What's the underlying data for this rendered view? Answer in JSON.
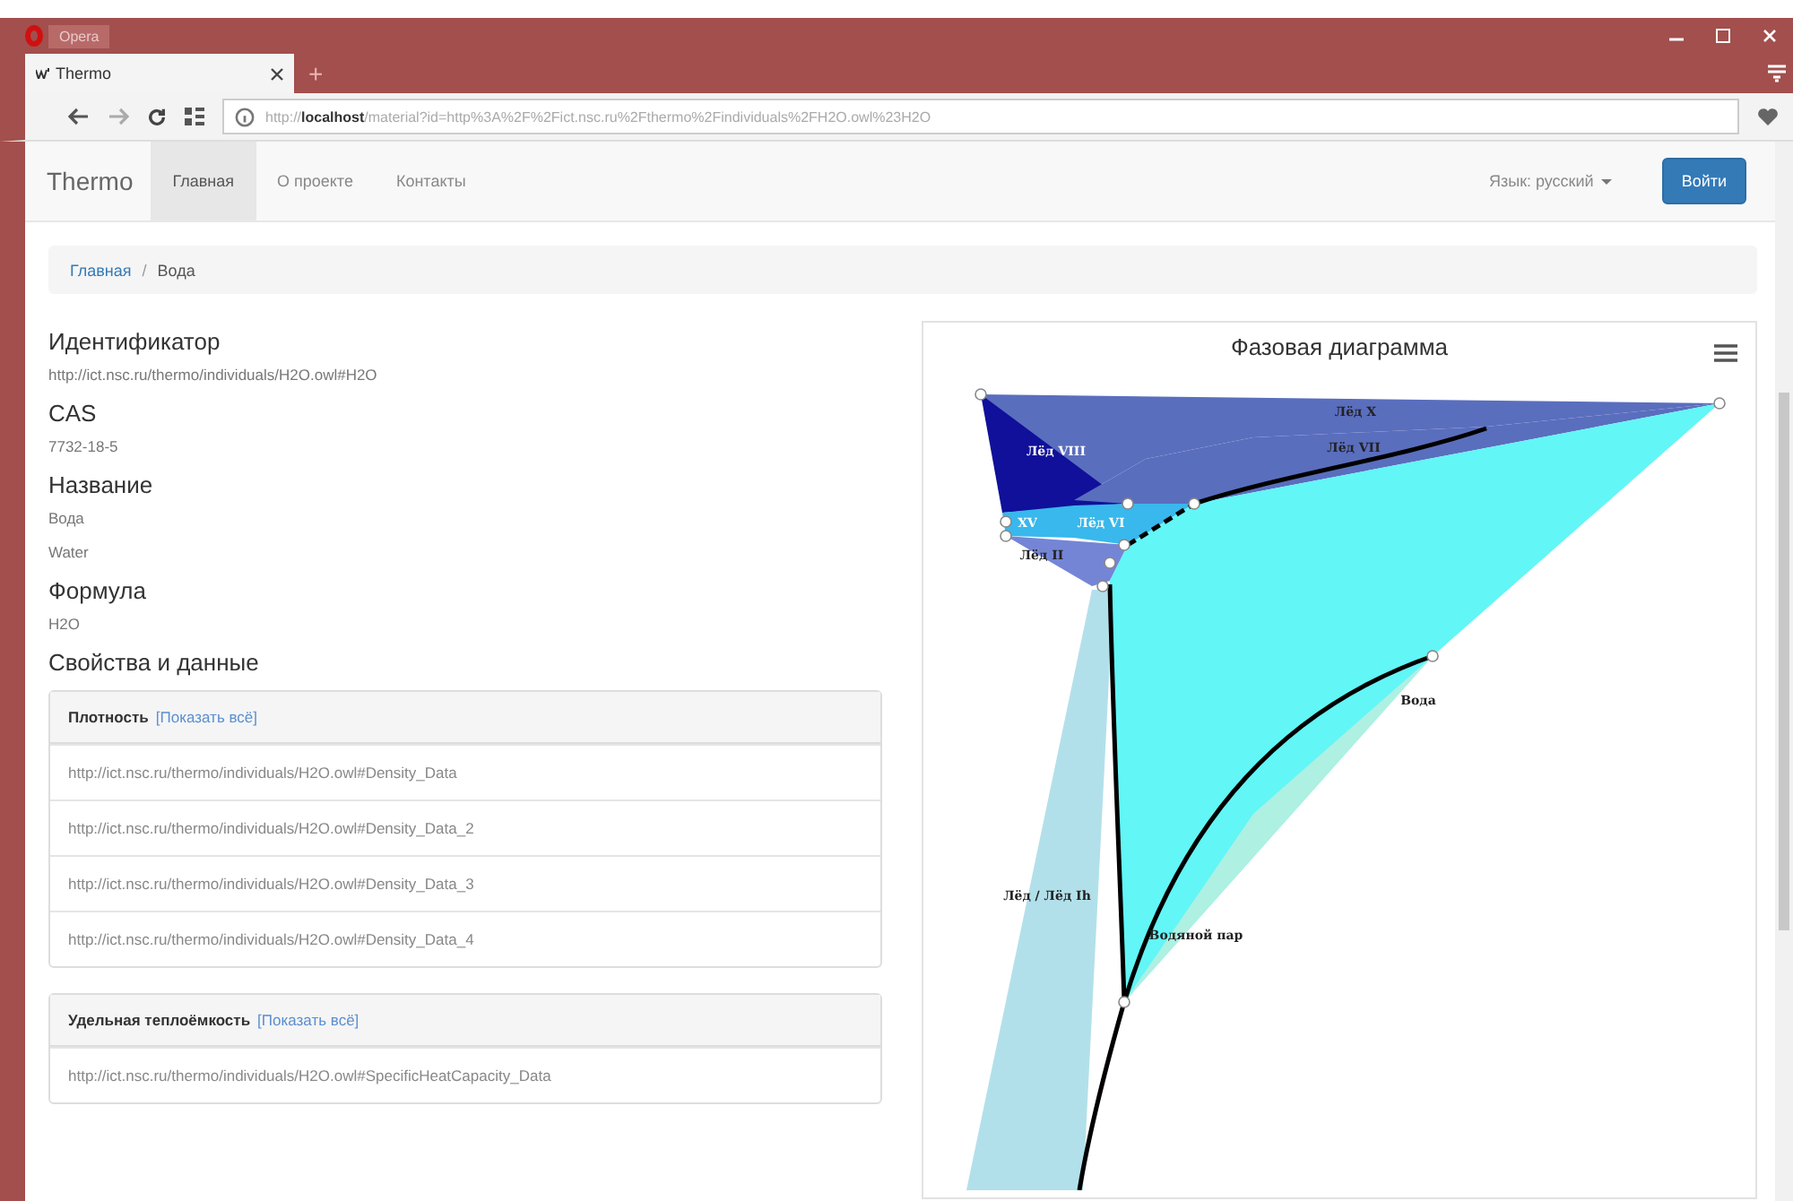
{
  "browser": {
    "app_label": "Opera",
    "tab_title": "Thermo",
    "new_tab": "+",
    "address": {
      "scheme": "http://",
      "host": "localhost",
      "path": "/material?id=http%3A%2F%2Fict.nsc.ru%2Fthermo%2Findividuals%2FH2O.owl%23H2O"
    }
  },
  "navbar": {
    "brand": "Thermo",
    "items": [
      {
        "label": "Главная",
        "selected": true
      },
      {
        "label": "О проекте",
        "selected": false
      },
      {
        "label": "Контакты",
        "selected": false
      }
    ],
    "language": "Язык: русский",
    "login": "Войти"
  },
  "breadcrumb_separator": "/",
  "breadcrumb": [
    {
      "label": "Главная",
      "kind": "link"
    },
    {
      "label": "Вода",
      "kind": "current"
    }
  ],
  "fields": [
    {
      "heading": "Идентификатор",
      "values": [
        "http://ict.nsc.ru/thermo/individuals/H2O.owl#H2O"
      ]
    },
    {
      "heading": "CAS",
      "values": [
        "7732-18-5"
      ]
    },
    {
      "heading": "Название",
      "values": [
        "Вода",
        "Water"
      ]
    },
    {
      "heading": "Формула",
      "values": [
        "H2O"
      ]
    }
  ],
  "properties_heading": "Свойства и данные",
  "property_panels": [
    {
      "title": "Плотность",
      "show_all": "[Показать всё]",
      "items": [
        "http://ict.nsc.ru/thermo/individuals/H2O.owl#Density_Data",
        "http://ict.nsc.ru/thermo/individuals/H2O.owl#Density_Data_2",
        "http://ict.nsc.ru/thermo/individuals/H2O.owl#Density_Data_3",
        "http://ict.nsc.ru/thermo/individuals/H2O.owl#Density_Data_4"
      ]
    },
    {
      "title": "Удельная теплоёмкость",
      "show_all": "[Показать всё]",
      "items": [
        "http://ict.nsc.ru/thermo/individuals/H2O.owl#SpecificHeatCapacity_Data"
      ]
    }
  ],
  "phase_diagram": {
    "title": "Фазовая диаграмма",
    "regions": [
      {
        "label": "Лёд X",
        "color": "#5a6ebe"
      },
      {
        "label": "Лёд VIII",
        "color": "#10109a"
      },
      {
        "label": "Лёд VII",
        "color": "#5a6ebe"
      },
      {
        "label": "XV",
        "color": "#38b8ec"
      },
      {
        "label": "Лёд VI",
        "color": "#38b8ec"
      },
      {
        "label": "Лёд II",
        "color": "#7585d6"
      },
      {
        "label": "Лёд / Лёд Ih",
        "color": "#b2e0ea"
      },
      {
        "label": "Водяной пар",
        "color": "#62f6f6"
      },
      {
        "label": "Вода",
        "color": "#aef0e2"
      }
    ]
  }
}
